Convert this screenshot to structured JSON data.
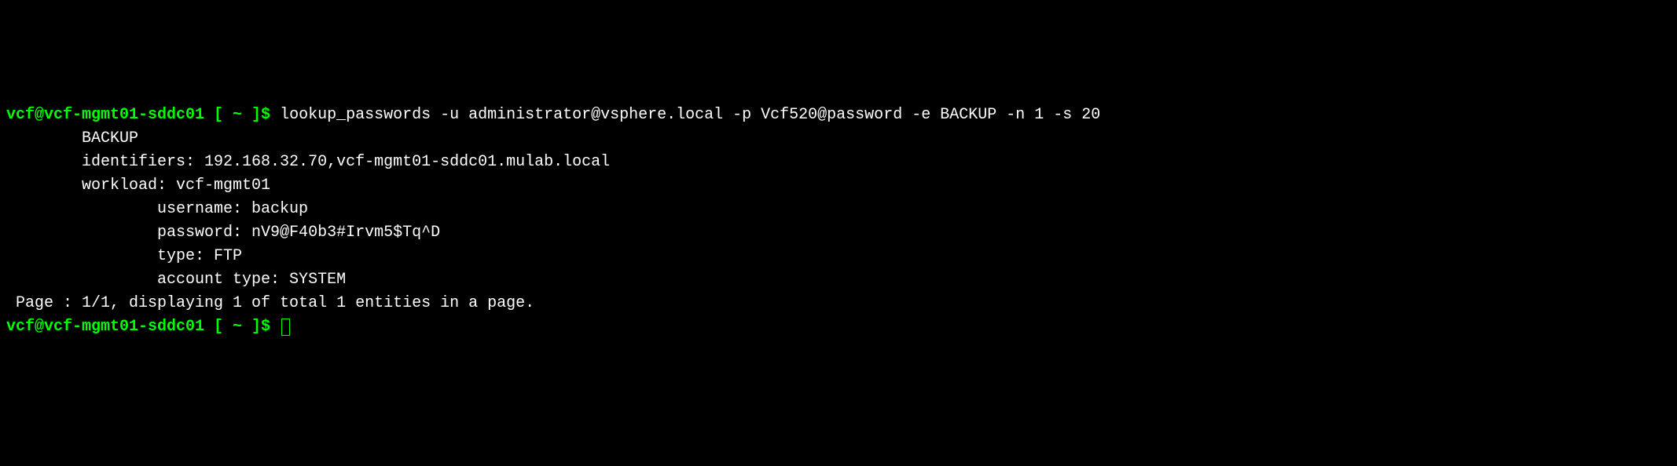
{
  "prompt1": {
    "user_host": "vcf@vcf-mgmt01-sddc01",
    "brackets": " [ ~ ]$ ",
    "command": "lookup_passwords -u administrator@vsphere.local -p Vcf520@password -e BACKUP -n 1 -s 20"
  },
  "output": {
    "blank1": "",
    "header": "        BACKUP",
    "identifiers": "        identifiers: 192.168.32.70,vcf-mgmt01-sddc01.mulab.local",
    "workload": "        workload: vcf-mgmt01",
    "username": "                username: backup",
    "password": "                password: nV9@F40b3#Irvm5$Tq^D",
    "type": "                type: FTP",
    "account_type": "                account type: SYSTEM",
    "blank2": "",
    "pager": " Page : 1/1, displaying 1 of total 1 entities in a page.",
    "blank3": ""
  },
  "prompt2": {
    "user_host": "vcf@vcf-mgmt01-sddc01",
    "brackets": " [ ~ ]$ "
  }
}
